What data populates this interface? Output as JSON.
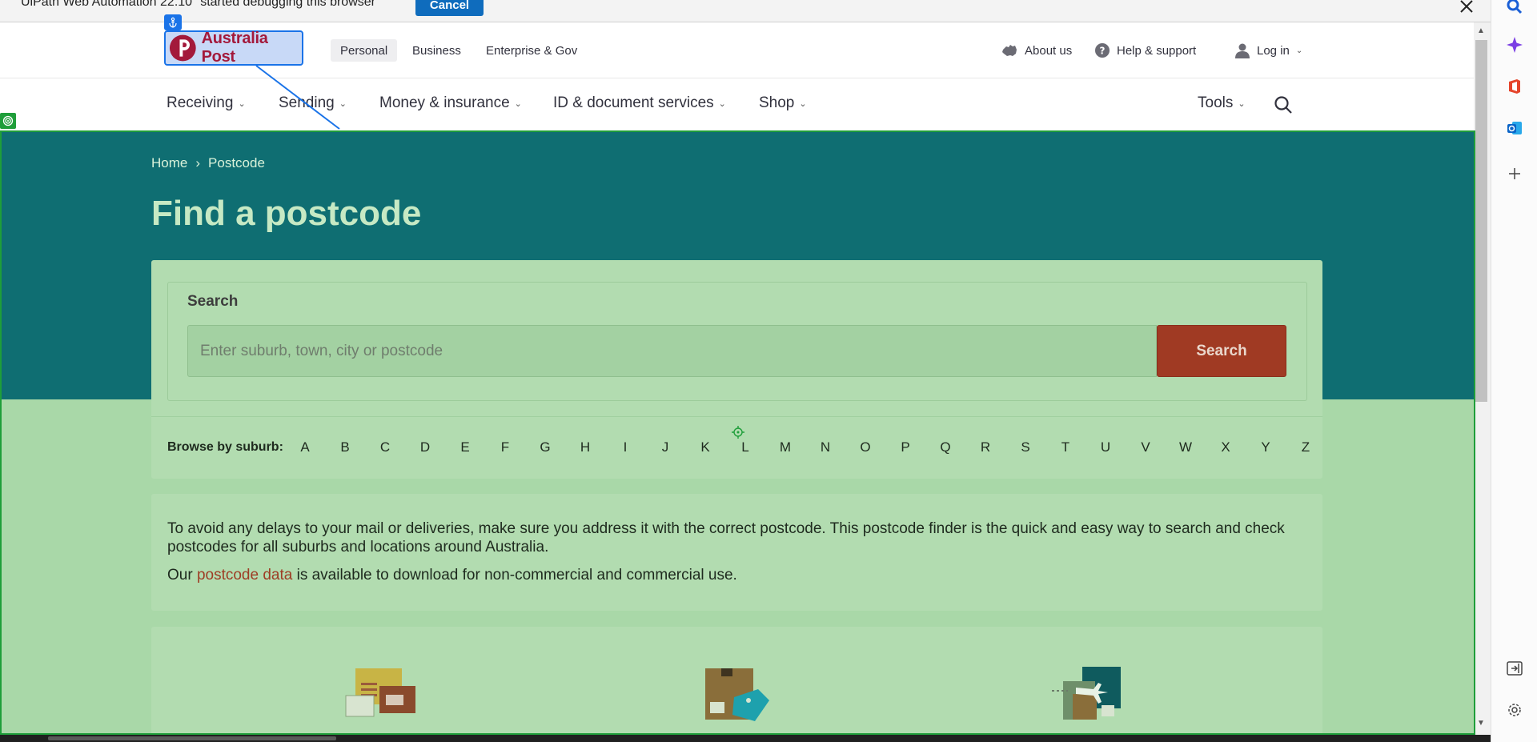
{
  "debug_bar": {
    "message": "UiPath Web Automation 22.10 \"started debugging this browser\"",
    "cancel_label": "Cancel"
  },
  "brand": {
    "logo_text": "Australia Post",
    "logo_color": "#a3193b"
  },
  "segments": [
    "Personal",
    "Business",
    "Enterprise & Gov"
  ],
  "utility_nav": {
    "about": "About us",
    "help": "Help & support",
    "login": "Log in"
  },
  "main_nav": [
    "Receiving",
    "Sending",
    "Money & insurance",
    "ID & document services",
    "Shop"
  ],
  "tools_label": "Tools",
  "breadcrumb": {
    "home": "Home",
    "separator": "›",
    "current": "Postcode"
  },
  "page_title": "Find a postcode",
  "search": {
    "label": "Search",
    "placeholder": "Enter suburb, town, city or postcode",
    "button_label": "Search"
  },
  "browse": {
    "label": "Browse by suburb:",
    "letters": [
      "A",
      "B",
      "C",
      "D",
      "E",
      "F",
      "G",
      "H",
      "I",
      "J",
      "K",
      "L",
      "M",
      "N",
      "O",
      "P",
      "Q",
      "R",
      "S",
      "T",
      "U",
      "V",
      "W",
      "X",
      "Y",
      "Z"
    ]
  },
  "info": {
    "paragraph1": "To avoid any delays to your mail or deliveries, make sure you address it with the correct postcode. This postcode finder is the quick and easy way to search and check postcodes for all suburbs and locations around Australia.",
    "p2_before": "Our ",
    "p2_link": "postcode data",
    "p2_after": " is available to download for non-commercial and commercial use."
  },
  "colors": {
    "hero_bg": "#0f6e72",
    "panel_bg": "#b2dcb0",
    "search_button": "#a03a23",
    "selection_frame": "#1f9e3a",
    "anchor_highlight": "#1a73e8"
  },
  "icons": [
    "close-icon",
    "search-icon",
    "copilot-icon",
    "office-icon",
    "outlook-icon",
    "add-icon",
    "sidebar-toggle-icon",
    "settings-icon",
    "australia-map-icon",
    "help-icon",
    "user-icon",
    "anchor-icon",
    "target-icon",
    "locator-icon",
    "letters-icon",
    "parcel-icon",
    "international-icon"
  ]
}
